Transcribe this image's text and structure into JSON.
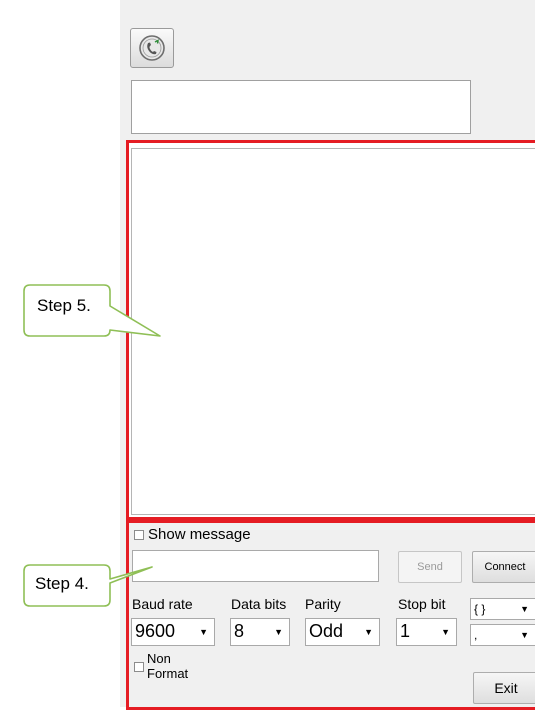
{
  "callouts": {
    "step5": "Step 5.",
    "step4": "Step 4."
  },
  "controls": {
    "show_message_label": "Show message",
    "send_label": "Send",
    "connect_label": "Connect",
    "exit_label": "Exit",
    "non_format_label_line1": "Non",
    "non_format_label_line2": "Format",
    "baud_rate": {
      "label": "Baud rate",
      "value": "9600"
    },
    "data_bits": {
      "label": "Data bits",
      "value": "8"
    },
    "parity": {
      "label": "Parity",
      "value": "Odd"
    },
    "stop_bit": {
      "label": "Stop bit",
      "value": "1"
    },
    "format_combo": {
      "value": "{ }"
    },
    "separator_combo": {
      "value": ","
    }
  },
  "colors": {
    "highlight": "#e51c23",
    "callout_border": "#8fbf56",
    "panel_bg": "#f0f0f0"
  },
  "icons": {
    "top_button": "phone-icon"
  }
}
